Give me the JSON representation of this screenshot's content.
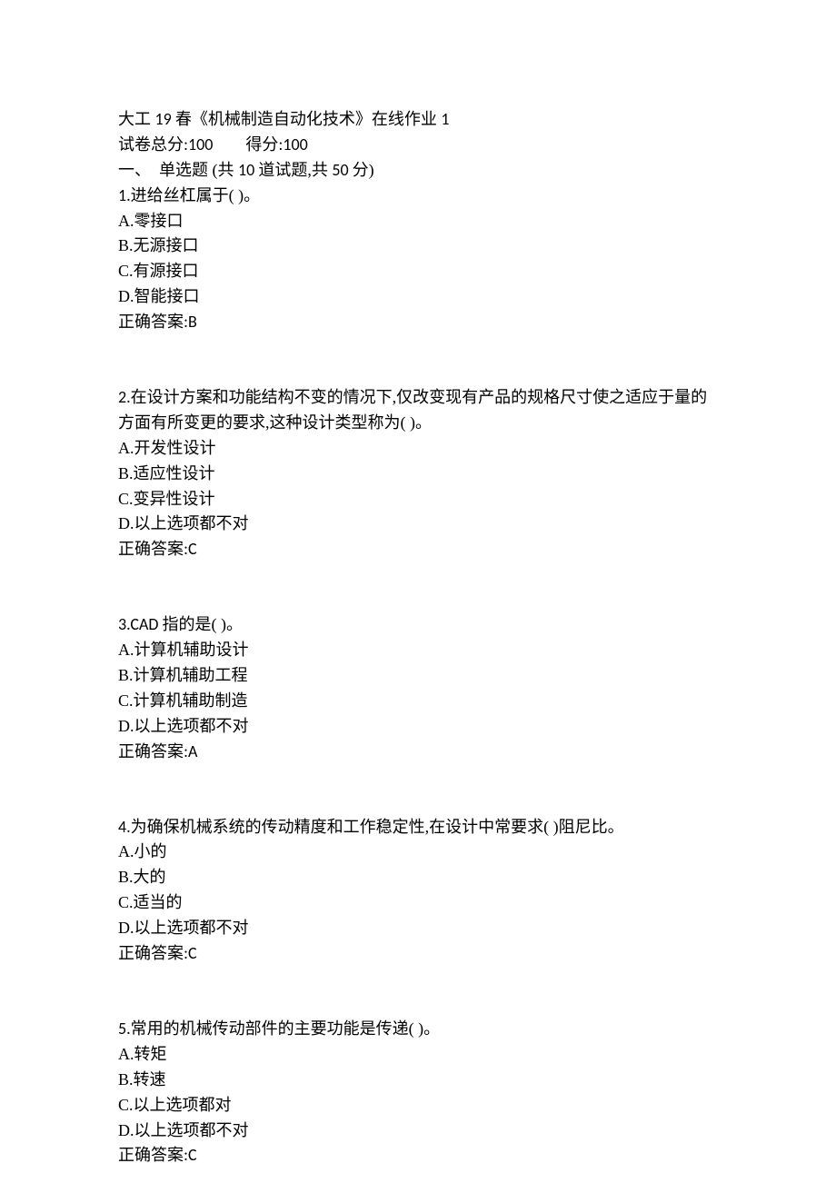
{
  "header": {
    "title_prefix": "大工 ",
    "title_num": "19 ",
    "title_suffix": "春《机械制造自动化技术》在线作业 ",
    "title_tail": "1",
    "score_line_prefix": "试卷总分:",
    "total_score": "100",
    "score_gap": "        ",
    "score_line_mid": "得分:",
    "obtained_score": "100",
    "section_prefix": "一、  单选题 (共 ",
    "section_count": "10 ",
    "section_mid": "道试题,共 ",
    "section_points": "50 ",
    "section_suffix": "分)"
  },
  "questions": [
    {
      "num": "1.",
      "stem": "进给丝杠属于( )。",
      "options": [
        "A.零接口",
        "B.无源接口",
        "C.有源接口",
        "D.智能接口"
      ],
      "answer_label": "正确答案:",
      "answer": "B"
    },
    {
      "num": "2.",
      "stem": "在设计方案和功能结构不变的情况下,仅改变现有产品的规格尺寸使之适应于量的方面有所变更的要求,这种设计类型称为( )。",
      "options": [
        "A.开发性设计",
        "B.适应性设计",
        "C.变异性设计",
        "D.以上选项都不对"
      ],
      "answer_label": "正确答案:",
      "answer": "C"
    },
    {
      "num": "3.",
      "stem_prefix": "CAD ",
      "stem": "指的是( )。",
      "options": [
        "A.计算机辅助设计",
        "B.计算机辅助工程",
        "C.计算机辅助制造",
        "D.以上选项都不对"
      ],
      "answer_label": "正确答案:",
      "answer": "A"
    },
    {
      "num": "4.",
      "stem": "为确保机械系统的传动精度和工作稳定性,在设计中常要求( )阻尼比。",
      "options": [
        "A.小的",
        "B.大的",
        "C.适当的",
        "D.以上选项都不对"
      ],
      "answer_label": "正确答案:",
      "answer": "C"
    },
    {
      "num": "5.",
      "stem": "常用的机械传动部件的主要功能是传递( )。",
      "options": [
        "A.转矩",
        "B.转速",
        "C.以上选项都对",
        "D.以上选项都不对"
      ],
      "answer_label": "正确答案:",
      "answer": "C"
    }
  ]
}
